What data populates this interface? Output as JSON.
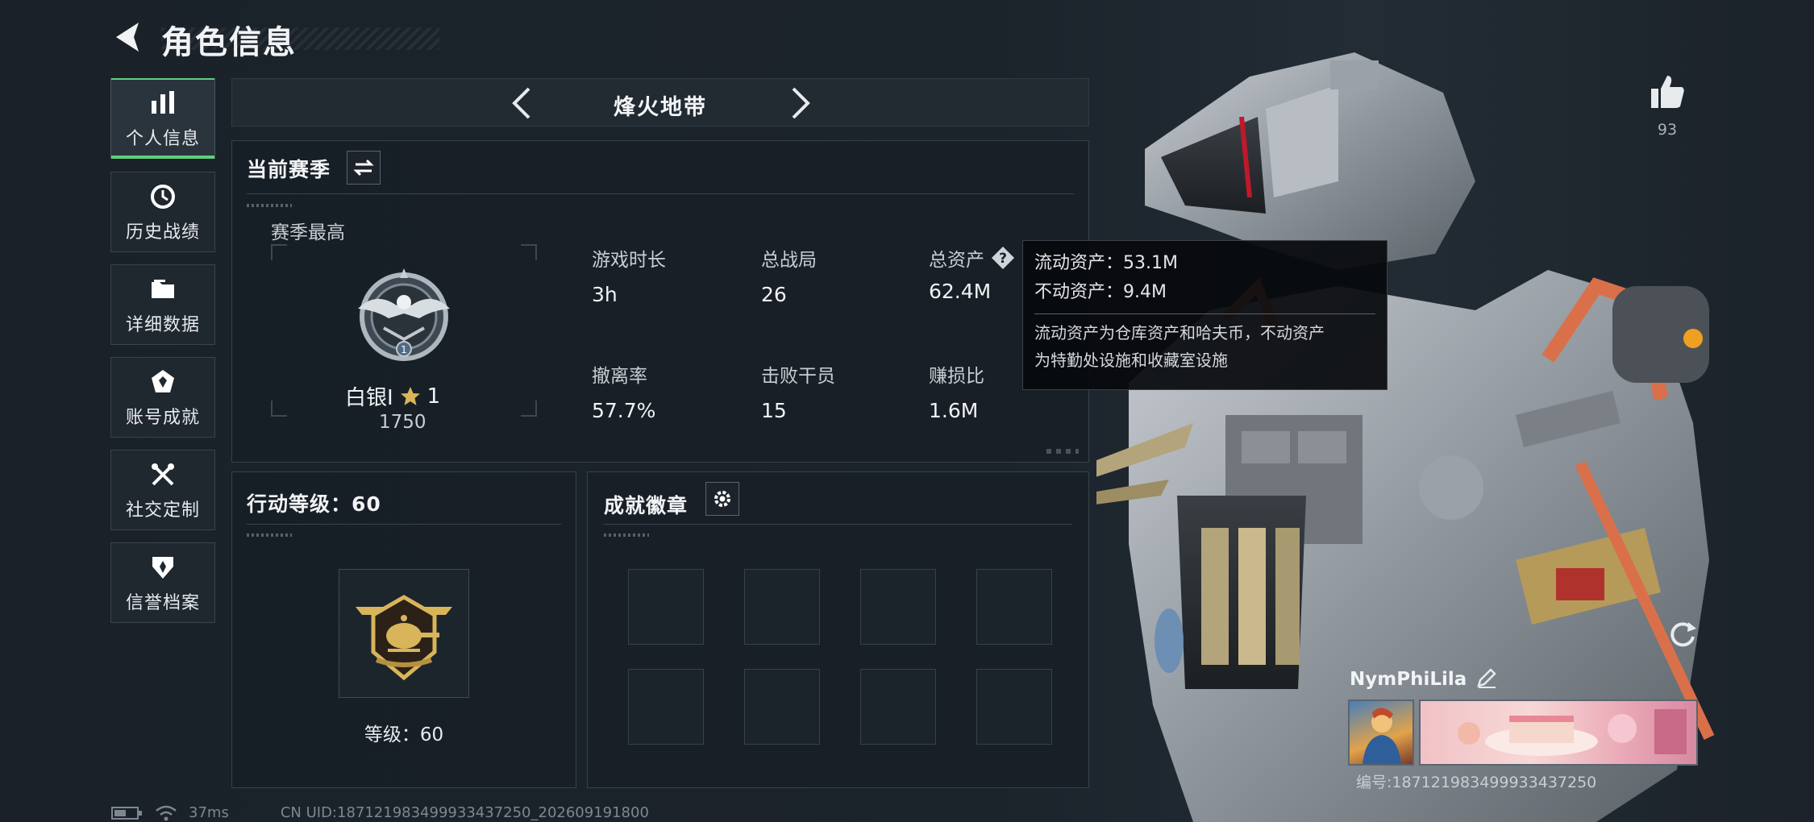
{
  "header": {
    "title": "角色信息"
  },
  "sidebar": {
    "items": [
      {
        "label": "个人信息",
        "icon": "bar-chart-icon",
        "active": true
      },
      {
        "label": "历史战绩",
        "icon": "history-clock-icon",
        "active": false
      },
      {
        "label": "详细数据",
        "icon": "folder-icon",
        "active": false
      },
      {
        "label": "账号成就",
        "icon": "achievement-icon",
        "active": false
      },
      {
        "label": "社交定制",
        "icon": "tools-icon",
        "active": false
      },
      {
        "label": "信誉档案",
        "icon": "shield-badge-icon",
        "active": false
      }
    ]
  },
  "map_selector": {
    "name": "烽火地带"
  },
  "season": {
    "title": "当前赛季",
    "best_label": "赛季最高",
    "rank_name": "白银Ⅰ",
    "rank_stars": "1",
    "rank_score": "1750",
    "stats": [
      {
        "label": "游戏时长",
        "value": "3h"
      },
      {
        "label": "总战局",
        "value": "26"
      },
      {
        "label": "总资产",
        "value": "62.4M"
      },
      {
        "label": "撤离率",
        "value": "57.7%"
      },
      {
        "label": "击败干员",
        "value": "15"
      },
      {
        "label": "赚损比",
        "value": "1.6M"
      }
    ]
  },
  "tooltip": {
    "liquid": "流动资产：53.1M",
    "fixed": "不动资产：9.4M",
    "note1": "流动资产为仓库资产和哈夫币，不动资产",
    "note2": "为特勤处设施和收藏室设施"
  },
  "action_level": {
    "title": "行动等级：60",
    "level_text": "等级：60"
  },
  "achievement_badges": {
    "title": "成就徽章",
    "slots": 8
  },
  "likes": {
    "count": "93"
  },
  "player": {
    "name": "NymPhiLila",
    "id_text": "编号:18712198349993343725​0"
  },
  "footer": {
    "ping": "37ms",
    "uid": "CN UID:18712198349993343725​0_202609191800"
  },
  "colors": {
    "accent": "#5fd07a",
    "gold": "#d8b55a",
    "panel": "#181f26"
  }
}
